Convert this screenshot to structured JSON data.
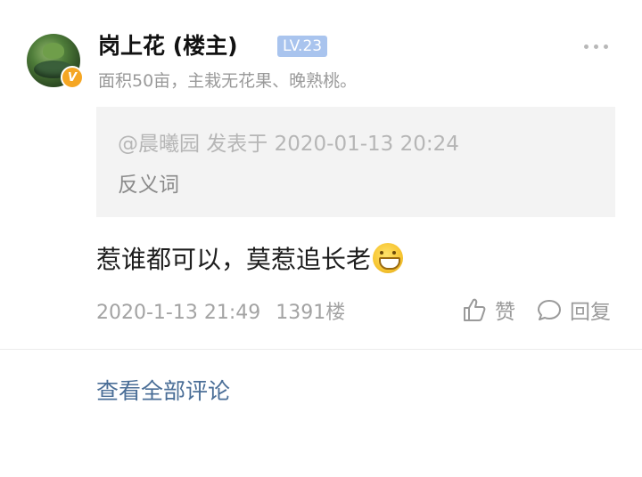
{
  "post": {
    "author": {
      "name": "岗上花 (楼主)",
      "level": "LV.23",
      "verified_badge": "V",
      "signature": "面积50亩，主栽无花果、晚熟桃。"
    },
    "more_icon": "more-dots-icon",
    "quote": {
      "meta": "@晨曦园 发表于 2020-01-13 20:24",
      "text": "反义词"
    },
    "content": "惹谁都可以，莫惹追长老",
    "emoji_icon": "grinning-face-icon",
    "timestamp": "2020-1-13 21:49",
    "floor": "1391楼",
    "actions": {
      "like_label": "赞",
      "reply_label": "回复"
    }
  },
  "footer": {
    "view_all_label": "查看全部评论"
  },
  "colors": {
    "level_badge": "#a9c4ee",
    "verified_badge": "#f5a623",
    "link": "#4a6e97",
    "quote_bg": "#f3f3f3"
  }
}
